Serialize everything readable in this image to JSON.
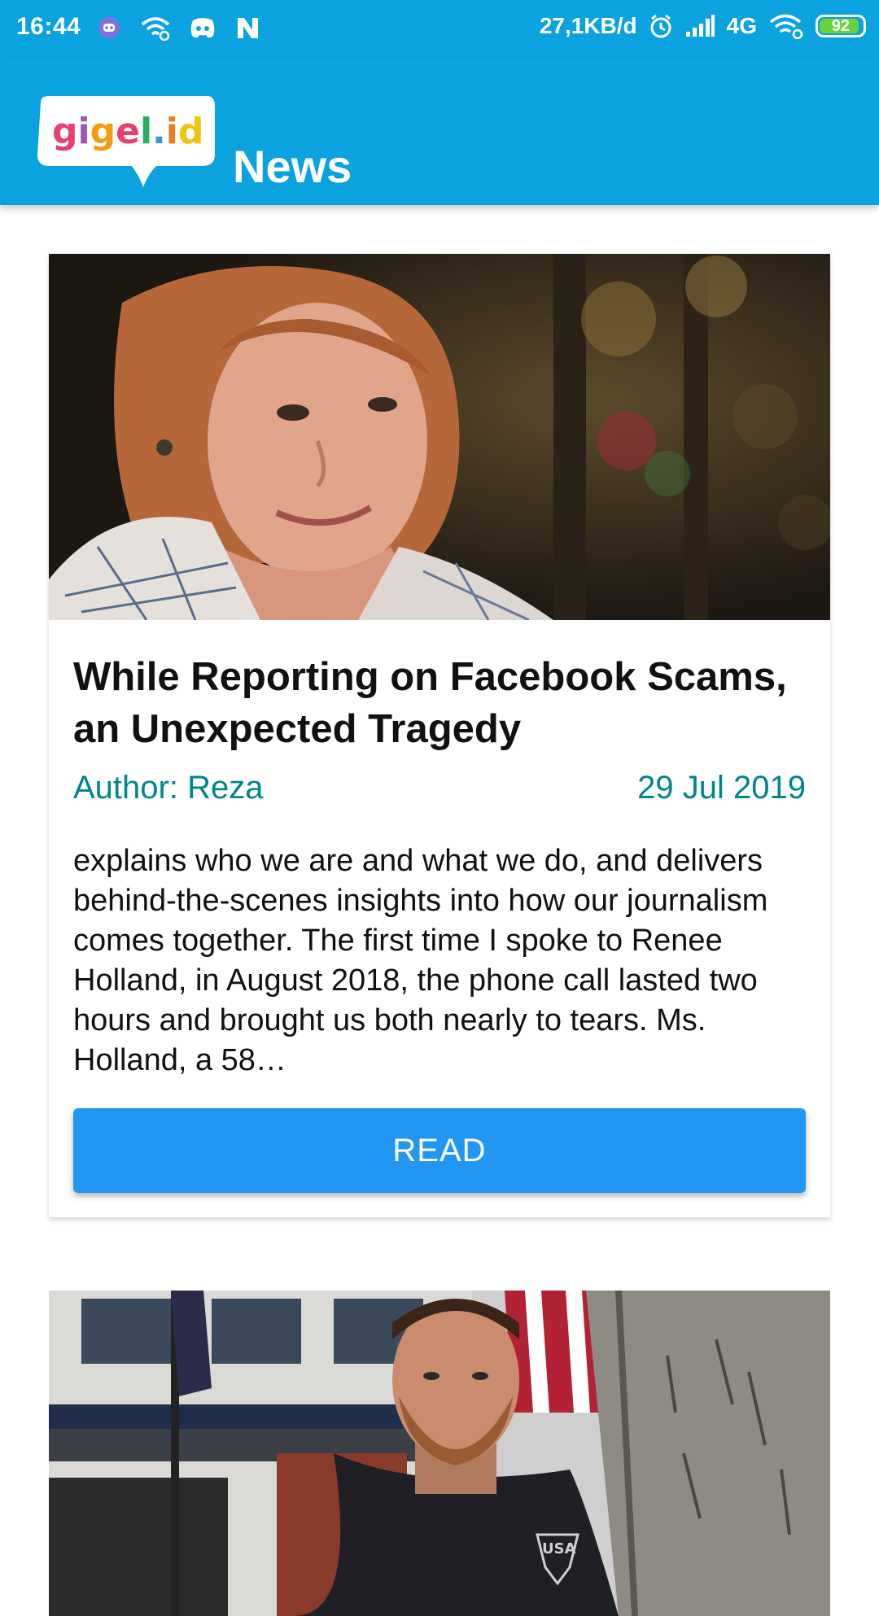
{
  "status_bar": {
    "time": "16:44",
    "data_rate": "27,1KB/d",
    "network": "4G",
    "battery_percent": "92",
    "battery_level": 0.92,
    "icons": [
      "discord-bubble-icon",
      "wifi-link-icon",
      "discord-icon",
      "n-app-icon",
      "alarm-icon",
      "signal-icon",
      "wifi-icon",
      "battery-icon"
    ]
  },
  "app_bar": {
    "logo_text": "gigel.id",
    "title": "News"
  },
  "articles": [
    {
      "title": "While Reporting on Facebook Scams, an Unexpected Tragedy",
      "author": "Author: Reza",
      "date": "29 Jul 2019",
      "excerpt": "explains who we are and what we do, and delivers behind-the-scenes insights into how our journalism comes together. The first time I spoke to Renee Holland, in August 2018, the phone call lasted two hours and brought us both nearly to tears. Ms. Holland, a 58…",
      "button_label": "READ"
    },
    {
      "shirt_text": "USA"
    }
  ],
  "colors": {
    "primary": "#0aa3e0",
    "accent": "#2196f3",
    "meta_text": "#00858a"
  }
}
